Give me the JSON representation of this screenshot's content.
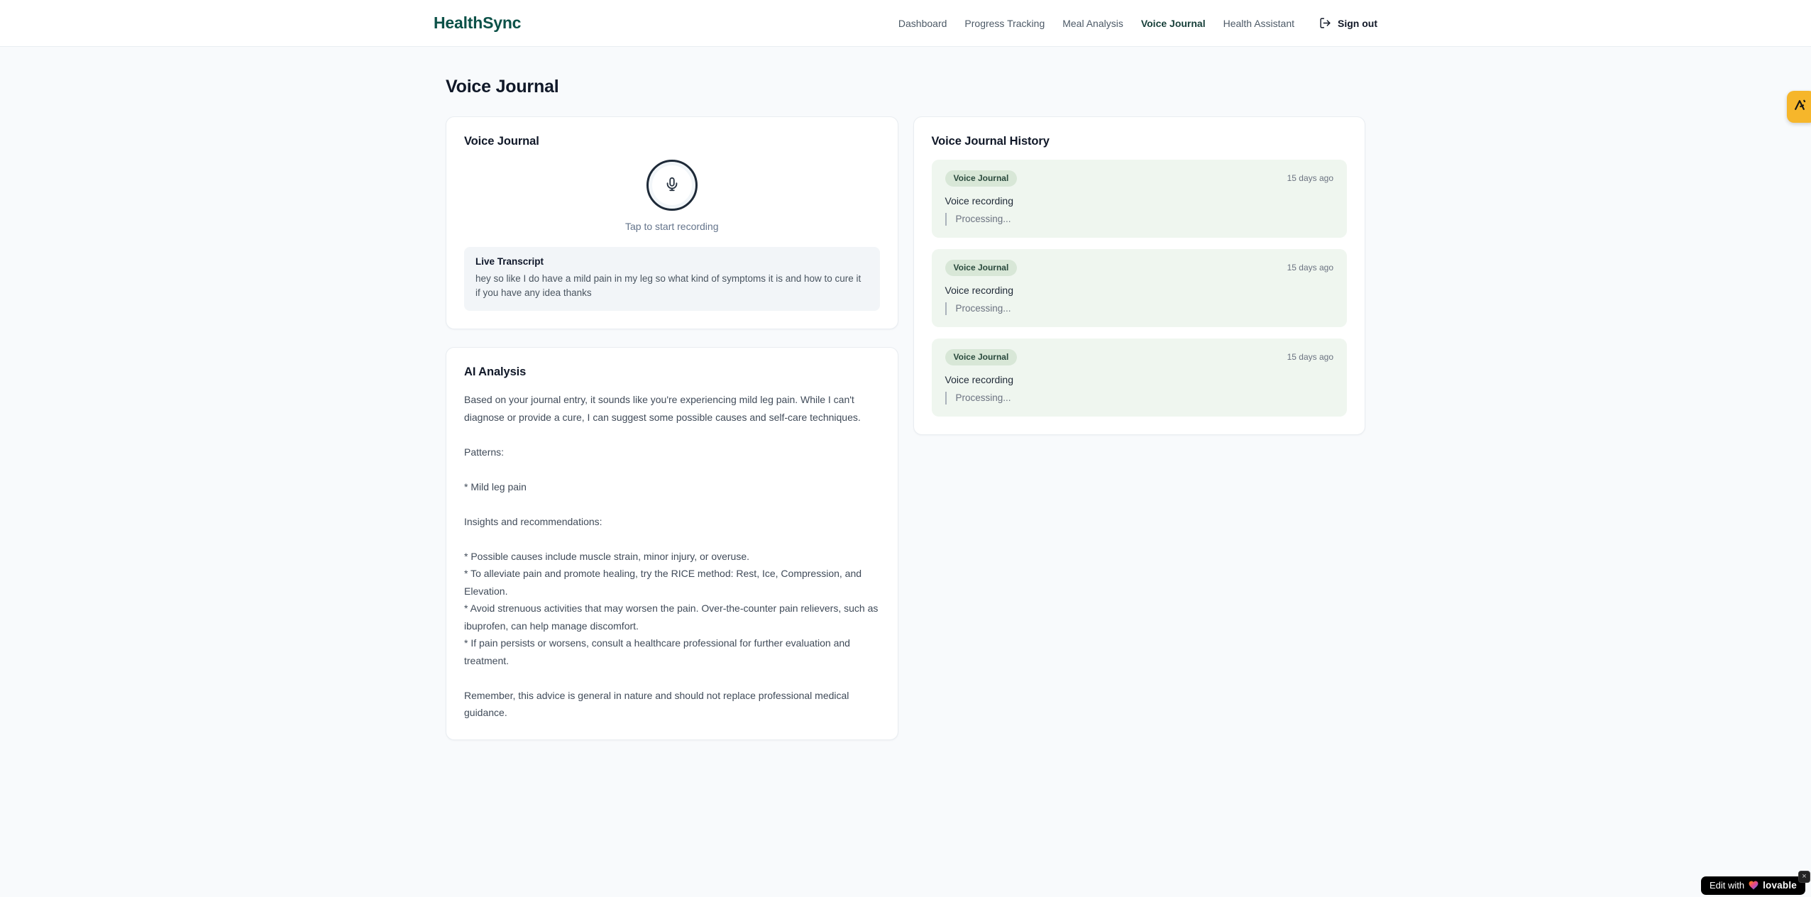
{
  "brand": {
    "name": "HealthSync"
  },
  "nav": {
    "items": [
      {
        "label": "Dashboard",
        "active": false
      },
      {
        "label": "Progress Tracking",
        "active": false
      },
      {
        "label": "Meal Analysis",
        "active": false
      },
      {
        "label": "Voice Journal",
        "active": true
      },
      {
        "label": "Health Assistant",
        "active": false
      }
    ],
    "sign_out_label": "Sign out"
  },
  "page": {
    "title": "Voice Journal"
  },
  "recorder": {
    "title": "Voice Journal",
    "tap_hint": "Tap to start recording",
    "transcript": {
      "title": "Live Transcript",
      "text": "hey so like I do have a mild pain in my leg so what kind of symptoms it is and how to cure it if you have any idea thanks"
    }
  },
  "analysis": {
    "title": "AI Analysis",
    "body": "Based on your journal entry, it sounds like you're experiencing mild leg pain. While I can't diagnose or provide a cure, I can suggest some possible causes and self-care techniques.\n\nPatterns:\n\n* Mild leg pain\n\nInsights and recommendations:\n\n* Possible causes include muscle strain, minor injury, or overuse.\n* To alleviate pain and promote healing, try the RICE method: Rest, Ice, Compression, and Elevation.\n* Avoid strenuous activities that may worsen the pain. Over-the-counter pain relievers, such as ibuprofen, can help manage discomfort.\n* If pain persists or worsens, consult a healthcare professional for further evaluation and treatment.\n\nRemember, this advice is general in nature and should not replace professional medical guidance."
  },
  "history": {
    "title": "Voice Journal History",
    "entries": [
      {
        "badge": "Voice Journal",
        "time": "15 days ago",
        "title": "Voice recording",
        "status": "Processing..."
      },
      {
        "badge": "Voice Journal",
        "time": "15 days ago",
        "title": "Voice recording",
        "status": "Processing..."
      },
      {
        "badge": "Voice Journal",
        "time": "15 days ago",
        "title": "Voice recording",
        "status": "Processing..."
      }
    ]
  },
  "edit_badge": {
    "prefix": "Edit with",
    "brand": "lovable",
    "close": "×"
  },
  "colors": {
    "brand_teal": "#0c5148",
    "accent_amber": "#f6b62b",
    "entry_green": "#eff6ef",
    "badge_green": "#d8e7d7",
    "page_bg": "#f8fafc"
  }
}
